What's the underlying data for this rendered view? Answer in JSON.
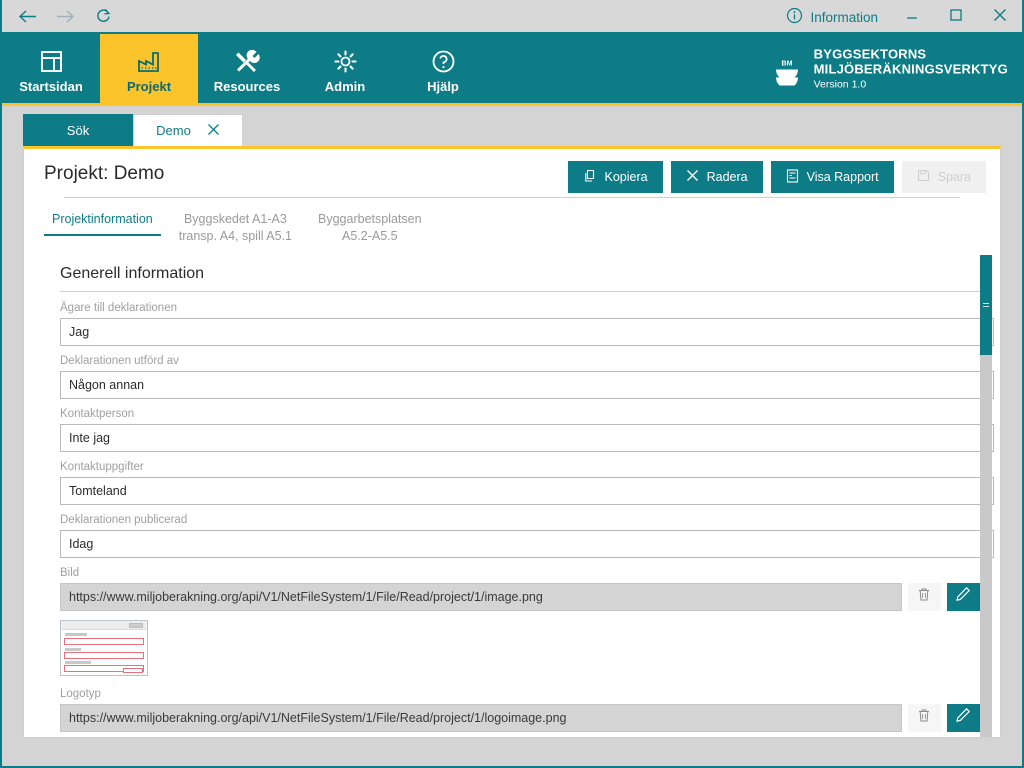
{
  "titlebar": {
    "back_icon": "arrow-left-icon",
    "forward_icon": "arrow-right-icon",
    "refresh_icon": "refresh-icon",
    "information_label": "Information",
    "information_icon": "info-circle-icon",
    "minimize_icon": "minimize-icon",
    "maximize_icon": "maximize-icon",
    "close_icon": "close-icon"
  },
  "nav": {
    "items": [
      {
        "label": "Startsidan",
        "icon": "dashboard-icon",
        "active": false
      },
      {
        "label": "Projekt",
        "icon": "factory-icon",
        "active": true
      },
      {
        "label": "Resources",
        "icon": "tools-icon",
        "active": false
      },
      {
        "label": "Admin",
        "icon": "gear-icon",
        "active": false
      },
      {
        "label": "Hjälp",
        "icon": "question-circle-icon",
        "active": false
      }
    ]
  },
  "brand": {
    "logo_text": "BM",
    "line1": "BYGGSEKTORNS",
    "line2": "MILJÖBERÄKNINGSVERKTYG",
    "version": "Version 1.0"
  },
  "document_tabs": [
    {
      "label": "Sök",
      "active": false,
      "closable": false
    },
    {
      "label": "Demo",
      "active": true,
      "closable": true,
      "close_icon": "close-icon"
    }
  ],
  "page": {
    "title": "Projekt: Demo"
  },
  "toolbar": {
    "buttons": [
      {
        "label": "Kopiera",
        "icon": "copy-icon",
        "disabled": false
      },
      {
        "label": "Radera",
        "icon": "close-icon",
        "disabled": false
      },
      {
        "label": "Visa Rapport",
        "icon": "report-icon",
        "disabled": false
      },
      {
        "label": "Spara",
        "icon": "save-icon",
        "disabled": true
      }
    ]
  },
  "sub_tabs": [
    {
      "label": "Projektinformation",
      "active": true
    },
    {
      "label": "Byggskedet A1-A3\ntransp. A4, spill A5.1",
      "active": false
    },
    {
      "label": "Byggarbetsplatsen\nA5.2-A5.5",
      "active": false
    }
  ],
  "form": {
    "section_title": "Generell information",
    "fields": [
      {
        "label": "Ägare till deklarationen",
        "value": "Jag",
        "type": "text"
      },
      {
        "label": "Deklarationen utförd av",
        "value": "Någon annan",
        "type": "text"
      },
      {
        "label": "Kontaktperson",
        "value": "Inte jag",
        "type": "text"
      },
      {
        "label": "Kontaktuppgifter",
        "value": "Tomteland",
        "type": "text"
      },
      {
        "label": "Deklarationen publicerad",
        "value": "Idag",
        "type": "text"
      },
      {
        "label": "Bild",
        "value": "https://www.miljoberakning.org/api/V1/NetFileSystem/1/File/Read/project/1/image.png",
        "type": "file",
        "delete_icon": "trash-icon",
        "edit_icon": "pencil-icon",
        "has_preview": true
      },
      {
        "label": "Logotyp",
        "value": "https://www.miljoberakning.org/api/V1/NetFileSystem/1/File/Read/project/1/logoimage.png",
        "type": "file",
        "delete_icon": "trash-icon",
        "edit_icon": "pencil-icon",
        "has_preview": false
      }
    ]
  },
  "scrollbar": {
    "grip_icon": "grip-lines-icon"
  },
  "colors": {
    "teal": "#0e7c86",
    "yellow": "#fcc42b",
    "panel_bg": "#ffffff",
    "window_bg": "#d4d4d4",
    "label_gray": "#a0a0a0"
  }
}
